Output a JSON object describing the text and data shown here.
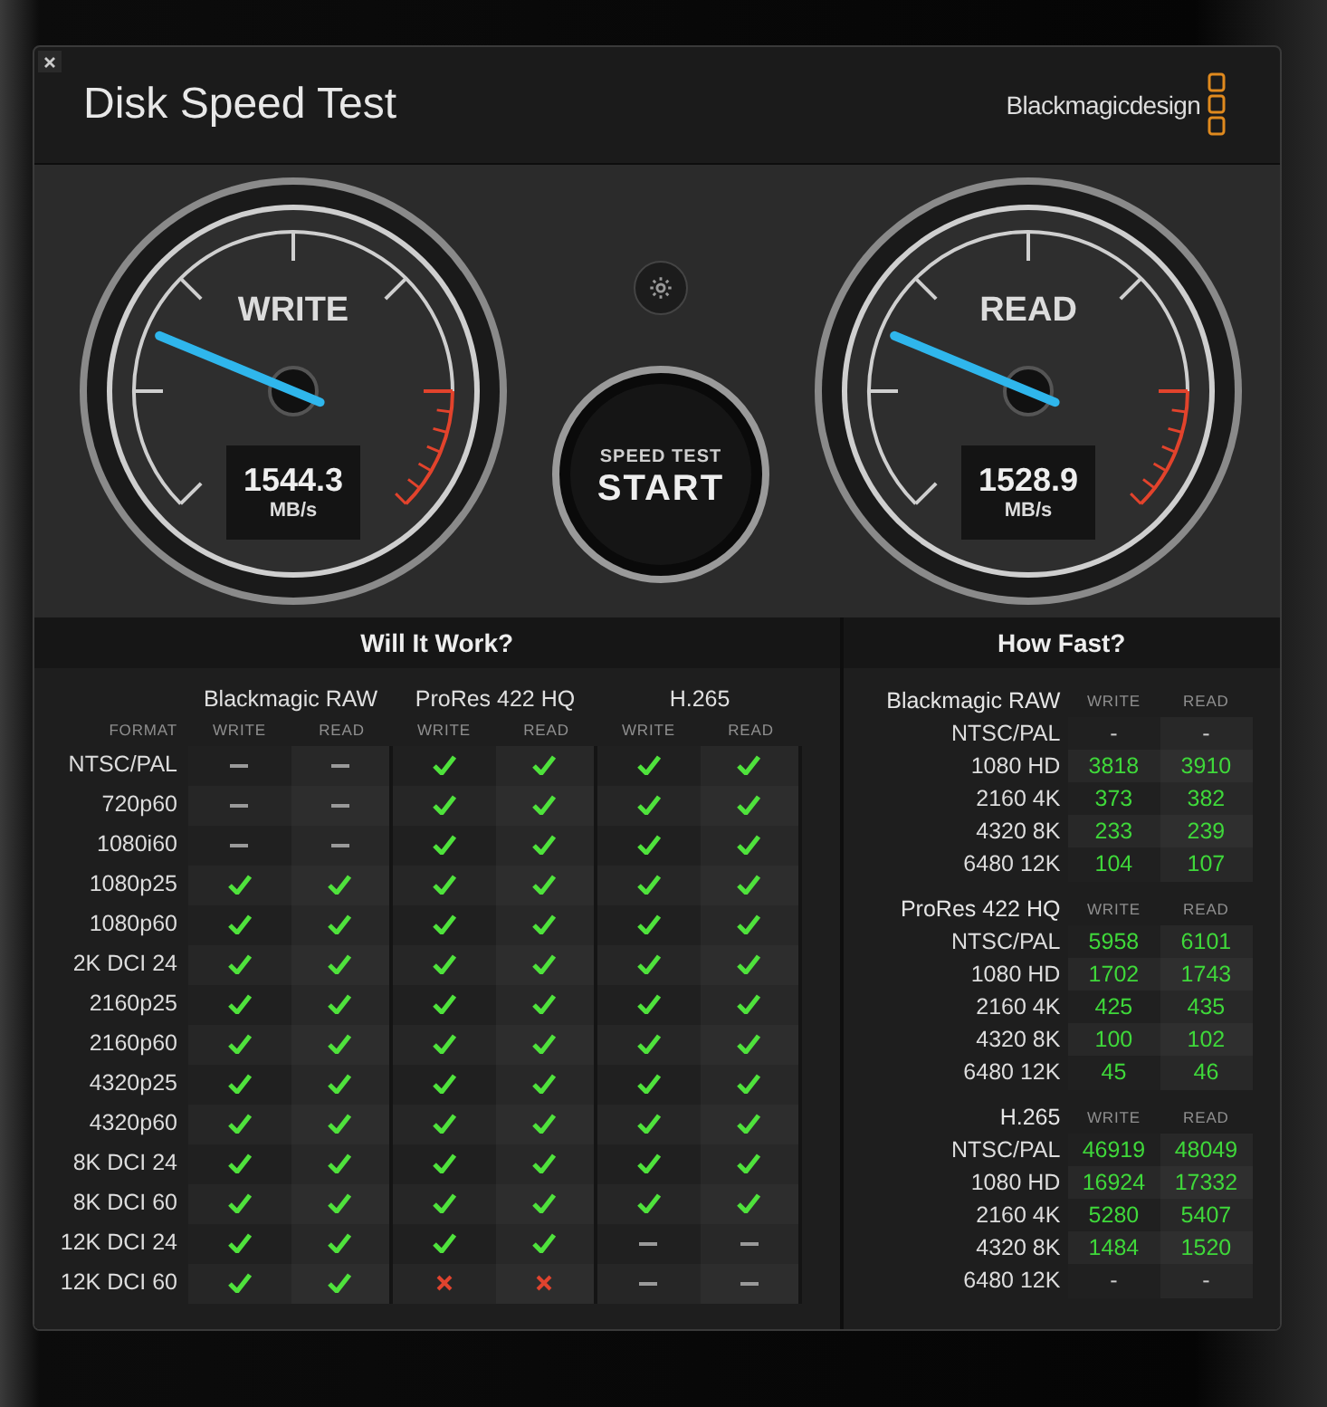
{
  "window": {
    "title": "Disk Speed Test",
    "brand": "Blackmagicdesign"
  },
  "gauges": [
    {
      "label": "WRITE",
      "reading": "1544.3",
      "unit": "MB/s",
      "level": 0.25
    },
    {
      "label": "READ",
      "reading": "1528.9",
      "unit": "MB/s",
      "level": 0.25
    }
  ],
  "start_button": {
    "caption": "SPEED TEST",
    "label": "START"
  },
  "will_it_work": {
    "title": "Will It Work?",
    "format_heading": "FORMAT",
    "codecs": [
      {
        "name": "Blackmagic RAW",
        "columns": [
          "WRITE",
          "READ"
        ]
      },
      {
        "name": "ProRes 422 HQ",
        "columns": [
          "WRITE",
          "READ"
        ]
      },
      {
        "name": "H.265",
        "columns": [
          "WRITE",
          "READ"
        ]
      }
    ],
    "rows": [
      {
        "format": "NTSC/PAL",
        "results": [
          {
            "applicable": false
          },
          {
            "applicable": false
          },
          {
            "applicable": true,
            "supported": true
          },
          {
            "applicable": true,
            "supported": true
          },
          {
            "applicable": true,
            "supported": true
          },
          {
            "applicable": true,
            "supported": true
          }
        ]
      },
      {
        "format": "720p60",
        "results": [
          {
            "applicable": false
          },
          {
            "applicable": false
          },
          {
            "applicable": true,
            "supported": true
          },
          {
            "applicable": true,
            "supported": true
          },
          {
            "applicable": true,
            "supported": true
          },
          {
            "applicable": true,
            "supported": true
          }
        ]
      },
      {
        "format": "1080i60",
        "results": [
          {
            "applicable": false
          },
          {
            "applicable": false
          },
          {
            "applicable": true,
            "supported": true
          },
          {
            "applicable": true,
            "supported": true
          },
          {
            "applicable": true,
            "supported": true
          },
          {
            "applicable": true,
            "supported": true
          }
        ]
      },
      {
        "format": "1080p25",
        "results": [
          {
            "applicable": true,
            "supported": true
          },
          {
            "applicable": true,
            "supported": true
          },
          {
            "applicable": true,
            "supported": true
          },
          {
            "applicable": true,
            "supported": true
          },
          {
            "applicable": true,
            "supported": true
          },
          {
            "applicable": true,
            "supported": true
          }
        ]
      },
      {
        "format": "1080p60",
        "results": [
          {
            "applicable": true,
            "supported": true
          },
          {
            "applicable": true,
            "supported": true
          },
          {
            "applicable": true,
            "supported": true
          },
          {
            "applicable": true,
            "supported": true
          },
          {
            "applicable": true,
            "supported": true
          },
          {
            "applicable": true,
            "supported": true
          }
        ]
      },
      {
        "format": "2K DCI 24",
        "results": [
          {
            "applicable": true,
            "supported": true
          },
          {
            "applicable": true,
            "supported": true
          },
          {
            "applicable": true,
            "supported": true
          },
          {
            "applicable": true,
            "supported": true
          },
          {
            "applicable": true,
            "supported": true
          },
          {
            "applicable": true,
            "supported": true
          }
        ]
      },
      {
        "format": "2160p25",
        "results": [
          {
            "applicable": true,
            "supported": true
          },
          {
            "applicable": true,
            "supported": true
          },
          {
            "applicable": true,
            "supported": true
          },
          {
            "applicable": true,
            "supported": true
          },
          {
            "applicable": true,
            "supported": true
          },
          {
            "applicable": true,
            "supported": true
          }
        ]
      },
      {
        "format": "2160p60",
        "results": [
          {
            "applicable": true,
            "supported": true
          },
          {
            "applicable": true,
            "supported": true
          },
          {
            "applicable": true,
            "supported": true
          },
          {
            "applicable": true,
            "supported": true
          },
          {
            "applicable": true,
            "supported": true
          },
          {
            "applicable": true,
            "supported": true
          }
        ]
      },
      {
        "format": "4320p25",
        "results": [
          {
            "applicable": true,
            "supported": true
          },
          {
            "applicable": true,
            "supported": true
          },
          {
            "applicable": true,
            "supported": true
          },
          {
            "applicable": true,
            "supported": true
          },
          {
            "applicable": true,
            "supported": true
          },
          {
            "applicable": true,
            "supported": true
          }
        ]
      },
      {
        "format": "4320p60",
        "results": [
          {
            "applicable": true,
            "supported": true
          },
          {
            "applicable": true,
            "supported": true
          },
          {
            "applicable": true,
            "supported": true
          },
          {
            "applicable": true,
            "supported": true
          },
          {
            "applicable": true,
            "supported": true
          },
          {
            "applicable": true,
            "supported": true
          }
        ]
      },
      {
        "format": "8K DCI 24",
        "results": [
          {
            "applicable": true,
            "supported": true
          },
          {
            "applicable": true,
            "supported": true
          },
          {
            "applicable": true,
            "supported": true
          },
          {
            "applicable": true,
            "supported": true
          },
          {
            "applicable": true,
            "supported": true
          },
          {
            "applicable": true,
            "supported": true
          }
        ]
      },
      {
        "format": "8K DCI 60",
        "results": [
          {
            "applicable": true,
            "supported": true
          },
          {
            "applicable": true,
            "supported": true
          },
          {
            "applicable": true,
            "supported": true
          },
          {
            "applicable": true,
            "supported": true
          },
          {
            "applicable": true,
            "supported": true
          },
          {
            "applicable": true,
            "supported": true
          }
        ]
      },
      {
        "format": "12K DCI 24",
        "results": [
          {
            "applicable": true,
            "supported": true
          },
          {
            "applicable": true,
            "supported": true
          },
          {
            "applicable": true,
            "supported": true
          },
          {
            "applicable": true,
            "supported": true
          },
          {
            "applicable": false
          },
          {
            "applicable": false
          }
        ]
      },
      {
        "format": "12K DCI 60",
        "results": [
          {
            "applicable": true,
            "supported": true
          },
          {
            "applicable": true,
            "supported": true
          },
          {
            "applicable": true,
            "supported": false
          },
          {
            "applicable": true,
            "supported": false
          },
          {
            "applicable": false
          },
          {
            "applicable": false
          }
        ]
      }
    ]
  },
  "how_fast": {
    "title": "How Fast?",
    "groups": [
      {
        "codec": "Blackmagic RAW",
        "columns": [
          "WRITE",
          "READ"
        ],
        "rows": [
          {
            "format": "NTSC/PAL",
            "write": "-",
            "read": "-"
          },
          {
            "format": "1080 HD",
            "write": "3818",
            "read": "3910"
          },
          {
            "format": "2160 4K",
            "write": "373",
            "read": "382"
          },
          {
            "format": "4320 8K",
            "write": "233",
            "read": "239"
          },
          {
            "format": "6480 12K",
            "write": "104",
            "read": "107"
          }
        ]
      },
      {
        "codec": "ProRes 422 HQ",
        "columns": [
          "WRITE",
          "READ"
        ],
        "rows": [
          {
            "format": "NTSC/PAL",
            "write": "5958",
            "read": "6101"
          },
          {
            "format": "1080 HD",
            "write": "1702",
            "read": "1743"
          },
          {
            "format": "2160 4K",
            "write": "425",
            "read": "435"
          },
          {
            "format": "4320 8K",
            "write": "100",
            "read": "102"
          },
          {
            "format": "6480 12K",
            "write": "45",
            "read": "46"
          }
        ]
      },
      {
        "codec": "H.265",
        "columns": [
          "WRITE",
          "READ"
        ],
        "rows": [
          {
            "format": "NTSC/PAL",
            "write": "46919",
            "read": "48049"
          },
          {
            "format": "1080 HD",
            "write": "16924",
            "read": "17332"
          },
          {
            "format": "2160 4K",
            "write": "5280",
            "read": "5407"
          },
          {
            "format": "4320 8K",
            "write": "1484",
            "read": "1520"
          },
          {
            "format": "6480 12K",
            "write": "-",
            "read": "-"
          }
        ]
      }
    ]
  }
}
